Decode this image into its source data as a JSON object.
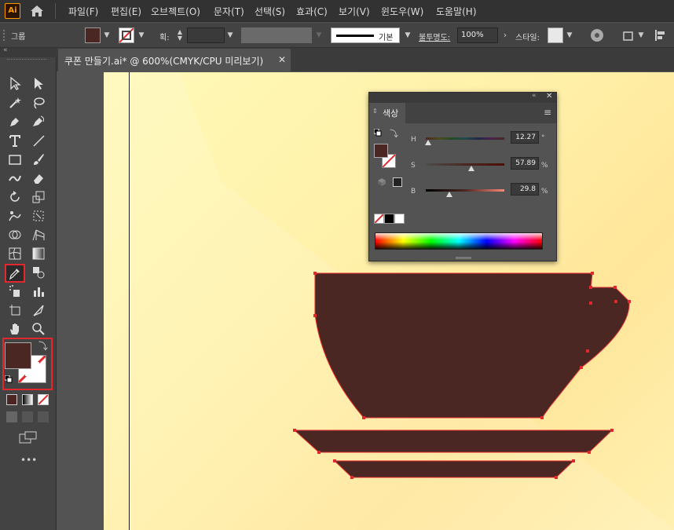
{
  "app": {
    "logo": "Ai"
  },
  "menu": [
    "파일(F)",
    "편집(E)",
    "오브젝트(O)",
    "문자(T)",
    "선택(S)",
    "효과(C)",
    "보기(V)",
    "윈도우(W)",
    "도움말(H)"
  ],
  "control": {
    "selection_label": "그룹",
    "stroke_weight_label": "획:",
    "stroke_style_label": "기본",
    "opacity_label": "불투명도:",
    "opacity_value": "100%",
    "style_label": "스타일:"
  },
  "document": {
    "tab_title": "쿠폰 만들기.ai* @ 600%(CMYK/CPU 미리보기)"
  },
  "colors": {
    "fill": "#4a2722",
    "accent_red": "#e0282d",
    "artboard": "#fff4a8"
  },
  "color_panel": {
    "tab_label": "색상",
    "h_label": "H",
    "h_value": "12.27",
    "h_unit": "°",
    "h": 12.27,
    "s_label": "S",
    "s_value": "57.89",
    "s_unit": "%",
    "s": 57.89,
    "b_label": "B",
    "b_value": "29.8",
    "b_unit": "%",
    "b": 29.8
  },
  "toolbar": {
    "more": "•••"
  }
}
